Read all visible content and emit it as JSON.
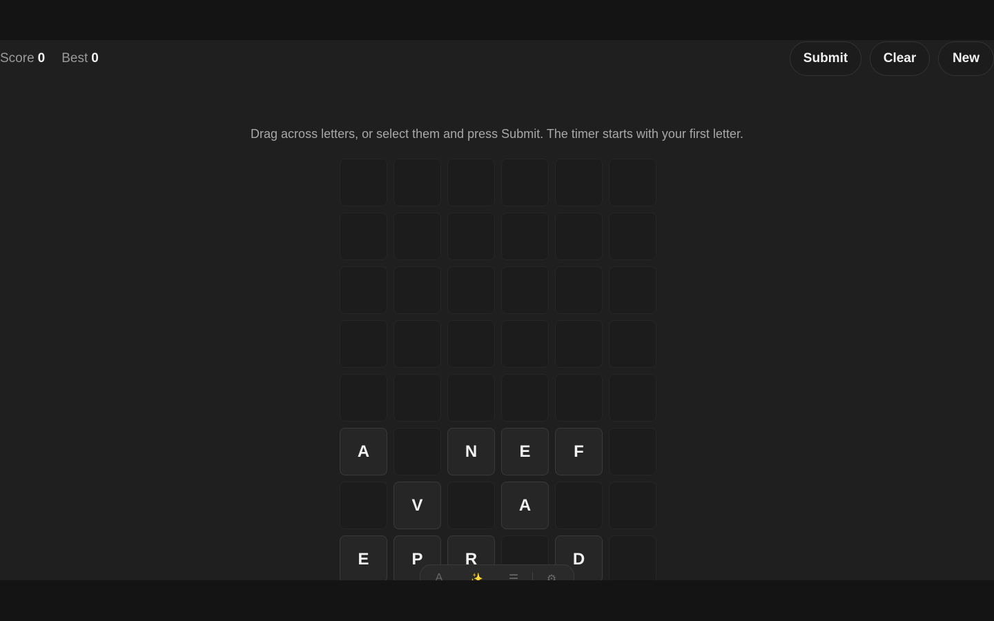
{
  "header": {
    "score_label": "Score",
    "score_value": "0",
    "best_label": "Best",
    "best_value": "0"
  },
  "actions": {
    "submit_label": "Submit",
    "clear_label": "Clear",
    "new_label": "New"
  },
  "instructions": "Drag across letters, or select them and press Submit. The timer starts with your first letter.",
  "board": {
    "columns": 6,
    "rows": [
      [
        "",
        "",
        "",
        "",
        "",
        ""
      ],
      [
        "",
        "",
        "",
        "",
        "",
        ""
      ],
      [
        "",
        "",
        "",
        "",
        "",
        ""
      ],
      [
        "",
        "",
        "",
        "",
        "",
        ""
      ],
      [
        "",
        "",
        "",
        "",
        "",
        ""
      ],
      [
        "A",
        "",
        "N",
        "E",
        "F",
        ""
      ],
      [
        "",
        "V",
        "",
        "A",
        "",
        ""
      ],
      [
        "E",
        "P",
        "R",
        "",
        "D",
        ""
      ]
    ]
  },
  "dock": {
    "icons": [
      "letter-icon",
      "clean-icon",
      "list-icon",
      "settings-icon"
    ]
  }
}
